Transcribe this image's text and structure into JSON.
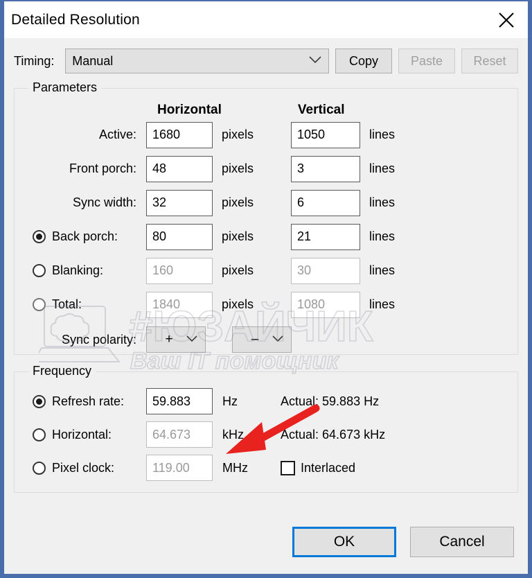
{
  "window": {
    "title": "Detailed Resolution",
    "close_icon": "close-icon"
  },
  "toolbar": {
    "timing_label": "Timing:",
    "timing_value": "Manual",
    "copy_label": "Copy",
    "paste_label": "Paste",
    "reset_label": "Reset"
  },
  "parameters": {
    "legend": "Parameters",
    "col_horizontal": "Horizontal",
    "col_vertical": "Vertical",
    "unit_pixels": "pixels",
    "unit_lines": "lines",
    "rows": [
      {
        "label": "Active:",
        "h": "1680",
        "v": "1050"
      },
      {
        "label": "Front porch:",
        "h": "48",
        "v": "3"
      },
      {
        "label": "Sync width:",
        "h": "32",
        "v": "6"
      },
      {
        "label": "Back porch:",
        "h": "80",
        "v": "21"
      },
      {
        "label": "Blanking:",
        "h": "160",
        "v": "30"
      },
      {
        "label": "Total:",
        "h": "1840",
        "v": "1080"
      }
    ],
    "sync_polarity_label": "Sync polarity:",
    "sync_polarity_h": "+",
    "sync_polarity_v": "–"
  },
  "frequency": {
    "legend": "Frequency",
    "refresh_label": "Refresh rate:",
    "refresh_value": "59.883",
    "refresh_unit": "Hz",
    "refresh_actual": "Actual: 59.883 Hz",
    "horizontal_label": "Horizontal:",
    "horizontal_value": "64.673",
    "horizontal_unit": "kHz",
    "horizontal_actual": "Actual: 64.673 kHz",
    "pixelclock_label": "Pixel clock:",
    "pixelclock_value": "119.00",
    "pixelclock_unit": "MHz",
    "interlaced_label": "Interlaced"
  },
  "footer": {
    "ok_label": "OK",
    "cancel_label": "Cancel"
  },
  "watermark": {
    "line1": "#ЮЗАЙЧИК",
    "line2": "Ваш IT помощник"
  },
  "colors": {
    "window_border": "#4a6ea9",
    "dialog_bg": "#f0f0f0",
    "accent_focus": "#0078d7",
    "arrow": "#e8231f",
    "disabled_text": "#a0a0a0"
  }
}
